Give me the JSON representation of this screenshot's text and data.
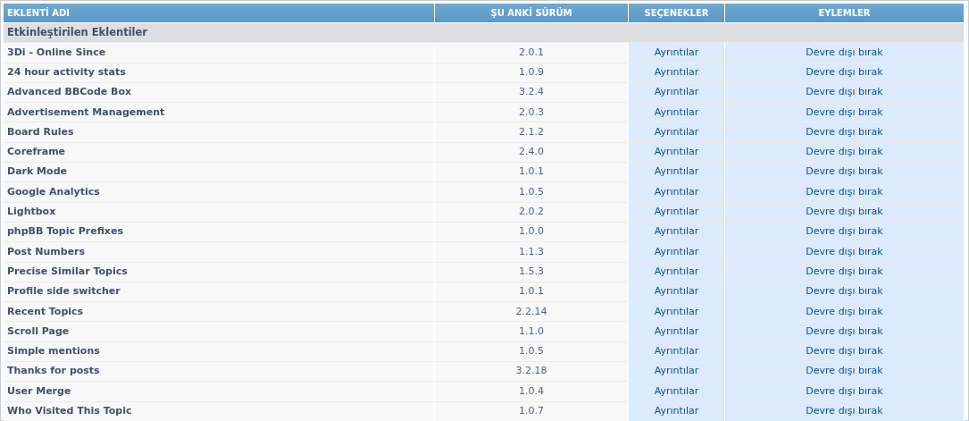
{
  "table": {
    "columns": [
      "EKLENTİ ADI",
      "ŞU ANKİ SÜRÜM",
      "SEÇENEKLER",
      "EYLEMLER"
    ],
    "section": "Etkinleştirilen Eklentiler",
    "rows": [
      {
        "name": "3Di - Online Since",
        "version": "2.0.1",
        "option": "Ayrıntılar",
        "action": "Devre dışı bırak"
      },
      {
        "name": "24 hour activity stats",
        "version": "1.0.9",
        "option": "Ayrıntılar",
        "action": "Devre dışı bırak"
      },
      {
        "name": "Advanced BBCode Box",
        "version": "3.2.4",
        "option": "Ayrıntılar",
        "action": "Devre dışı bırak"
      },
      {
        "name": "Advertisement Management",
        "version": "2.0.3",
        "option": "Ayrıntılar",
        "action": "Devre dışı bırak"
      },
      {
        "name": "Board Rules",
        "version": "2.1.2",
        "option": "Ayrıntılar",
        "action": "Devre dışı bırak"
      },
      {
        "name": "Coreframe",
        "version": "2.4.0",
        "option": "Ayrıntılar",
        "action": "Devre dışı bırak"
      },
      {
        "name": "Dark Mode",
        "version": "1.0.1",
        "option": "Ayrıntılar",
        "action": "Devre dışı bırak"
      },
      {
        "name": "Google Analytics",
        "version": "1.0.5",
        "option": "Ayrıntılar",
        "action": "Devre dışı bırak"
      },
      {
        "name": "Lightbox",
        "version": "2.0.2",
        "option": "Ayrıntılar",
        "action": "Devre dışı bırak"
      },
      {
        "name": "phpBB Topic Prefixes",
        "version": "1.0.0",
        "option": "Ayrıntılar",
        "action": "Devre dışı bırak"
      },
      {
        "name": "Post Numbers",
        "version": "1.1.3",
        "option": "Ayrıntılar",
        "action": "Devre dışı bırak"
      },
      {
        "name": "Precise Similar Topics",
        "version": "1.5.3",
        "option": "Ayrıntılar",
        "action": "Devre dışı bırak"
      },
      {
        "name": "Profile side switcher",
        "version": "1.0.1",
        "option": "Ayrıntılar",
        "action": "Devre dışı bırak"
      },
      {
        "name": "Recent Topics",
        "version": "2.2.14",
        "option": "Ayrıntılar",
        "action": "Devre dışı bırak"
      },
      {
        "name": "Scroll Page",
        "version": "1.1.0",
        "option": "Ayrıntılar",
        "action": "Devre dışı bırak"
      },
      {
        "name": "Simple mentions",
        "version": "1.0.5",
        "option": "Ayrıntılar",
        "action": "Devre dışı bırak"
      },
      {
        "name": "Thanks for posts",
        "version": "3.2.18",
        "option": "Ayrıntılar",
        "action": "Devre dışı bırak"
      },
      {
        "name": "User Merge",
        "version": "1.0.4",
        "option": "Ayrıntılar",
        "action": "Devre dışı bırak"
      },
      {
        "name": "Who Visited This Topic",
        "version": "1.0.7",
        "option": "Ayrıntılar",
        "action": "Devre dışı bırak"
      }
    ]
  }
}
